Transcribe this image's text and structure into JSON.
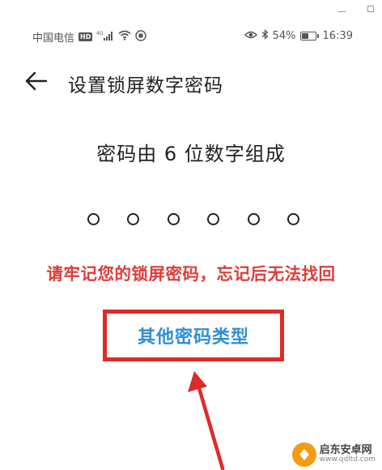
{
  "window": {
    "minimize_icon": "minimize-icon",
    "maximize_icon": "maximize-icon"
  },
  "statusbar": {
    "carrier": "中国电信",
    "hd": "HD",
    "network": "4G",
    "battery_percent": "54%",
    "battery_level": 0.54,
    "time": "16:39"
  },
  "header": {
    "title": "设置锁屏数字密码"
  },
  "main": {
    "prompt": "密码由 6 位数字组成",
    "pin_length": 6,
    "warning": "请牢记您的锁屏密码，忘记后无法找回",
    "other_types_label": "其他密码类型"
  },
  "colors": {
    "accent_blue": "#2f8fd6",
    "annotation_red": "#e02a2a",
    "warning_red": "#e03b3b"
  },
  "watermark": {
    "name": "启东安卓网",
    "url": "www.qdltd.com"
  }
}
